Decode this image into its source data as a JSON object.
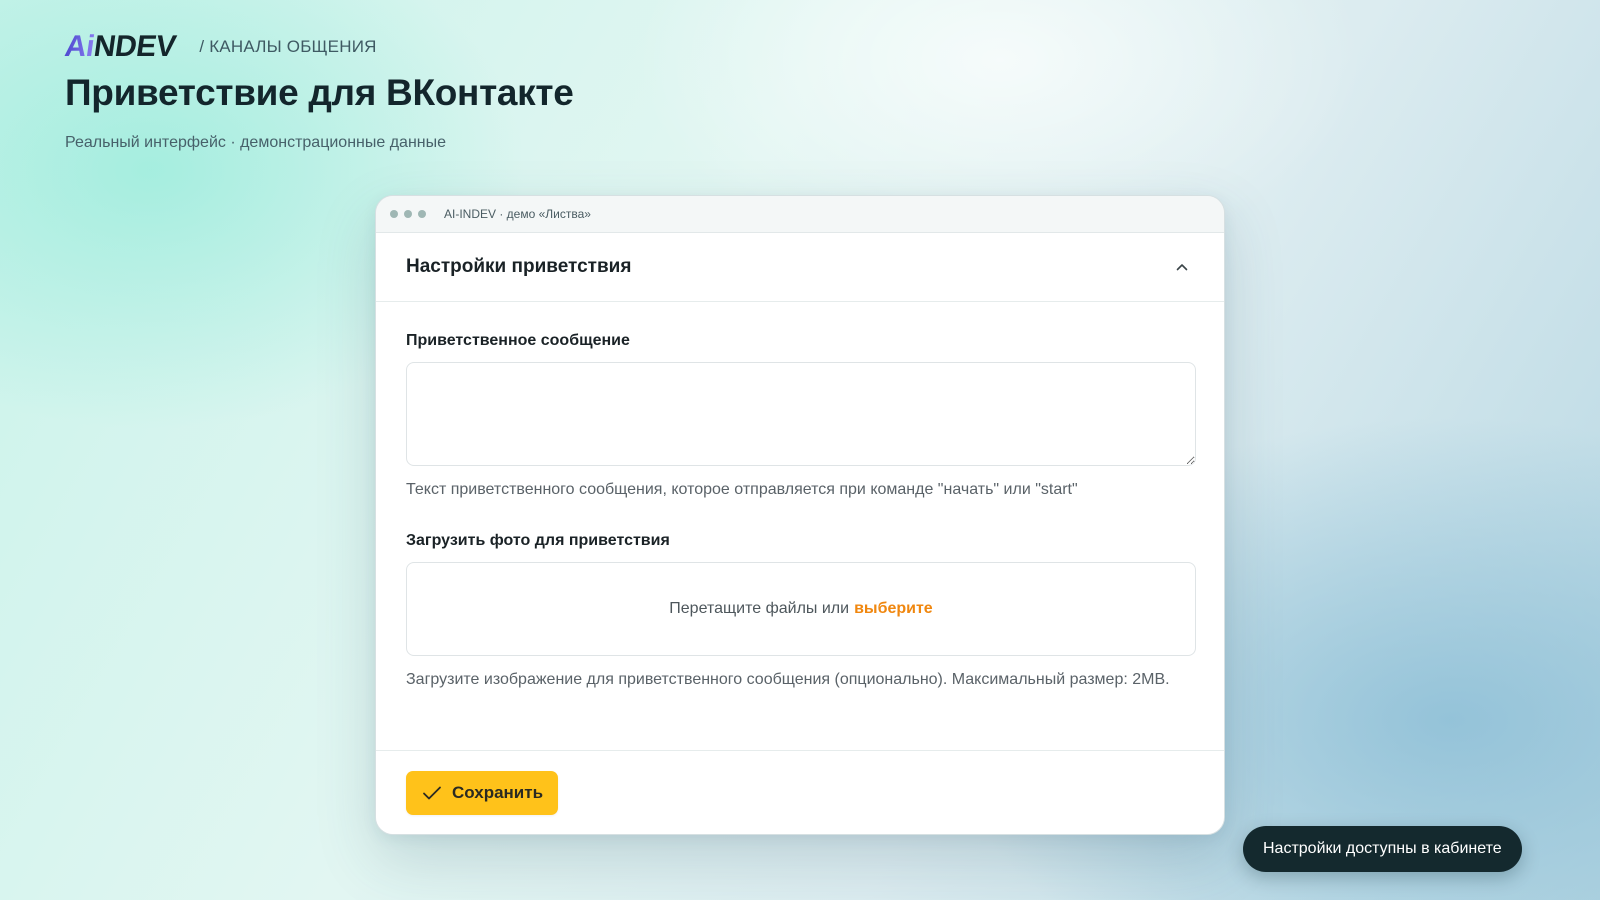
{
  "header": {
    "logo_accent": "Ai",
    "logo_main": "NDEV",
    "breadcrumb": "/ КАНАЛЫ ОБЩЕНИЯ",
    "title": "Приветствие для ВКонтакте",
    "subtitle": "Реальный интерфейс · демонстрационные данные"
  },
  "window": {
    "title": "AI-INDEV · демо «Листва»"
  },
  "panel": {
    "title": "Настройки приветствия",
    "collapse_icon": "chevron-up-icon",
    "message": {
      "label": "Приветственное сообщение",
      "value": "",
      "placeholder": "",
      "hint": "Текст приветственного сообщения, которое отправляется при команде \"начать\" или \"start\""
    },
    "photo": {
      "label": "Загрузить фото для приветствия",
      "drop_text": "Перетащите файлы или",
      "drop_link": "выберите",
      "hint": "Загрузите изображение для приветственного сообщения (опционально). Максимальный размер: 2MB."
    },
    "save_label": "Сохранить",
    "save_icon": "check-icon"
  },
  "toast": {
    "text": "Настройки доступны в кабинете"
  },
  "colors": {
    "accent_button": "#ffc21a",
    "link": "#f0870f",
    "logo_accent": "#5b52d6",
    "toast_bg": "#14292e"
  }
}
